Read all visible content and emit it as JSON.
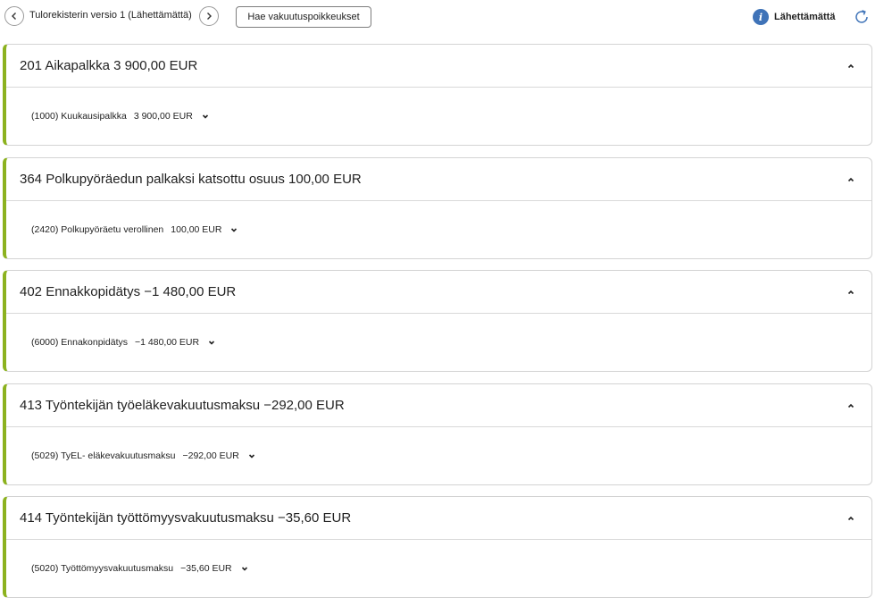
{
  "topbar": {
    "version_title": "Tulorekisterin versio 1 (Lähettämättä)",
    "fetch_button": "Hae vakuutuspoikkeukset",
    "status_text": "Lähettämättä",
    "info_icon_glyph": "i",
    "prev_icon": "chevron-left-icon",
    "next_icon": "chevron-right-icon",
    "refresh_icon": "refresh-icon"
  },
  "colors": {
    "accent": "#8cb21f",
    "info": "#3f73b8",
    "refresh": "#3f73b8"
  },
  "cards": [
    {
      "title": "201 Aikapalkka 3 900,00 EUR",
      "row_label": "(1000) Kuukausipalkka",
      "row_amount": "3 900,00 EUR"
    },
    {
      "title": "364 Polkupyöräedun palkaksi katsottu osuus 100,00 EUR",
      "row_label": "(2420) Polkupyöräetu verollinen",
      "row_amount": "100,00 EUR"
    },
    {
      "title": "402 Ennakkopidätys −1 480,00 EUR",
      "row_label": "(6000) Ennakonpidätys",
      "row_amount": "−1 480,00 EUR"
    },
    {
      "title": "413 Työntekijän työeläkevakuutusmaksu −292,00 EUR",
      "row_label": "(5029) TyEL- eläkevakuutusmaksu",
      "row_amount": "−292,00 EUR"
    },
    {
      "title": "414 Työntekijän työttömyysvakuutusmaksu −35,60 EUR",
      "row_label": "(5020) Työttömyysvakuutusmaksu",
      "row_amount": "−35,60 EUR"
    }
  ]
}
